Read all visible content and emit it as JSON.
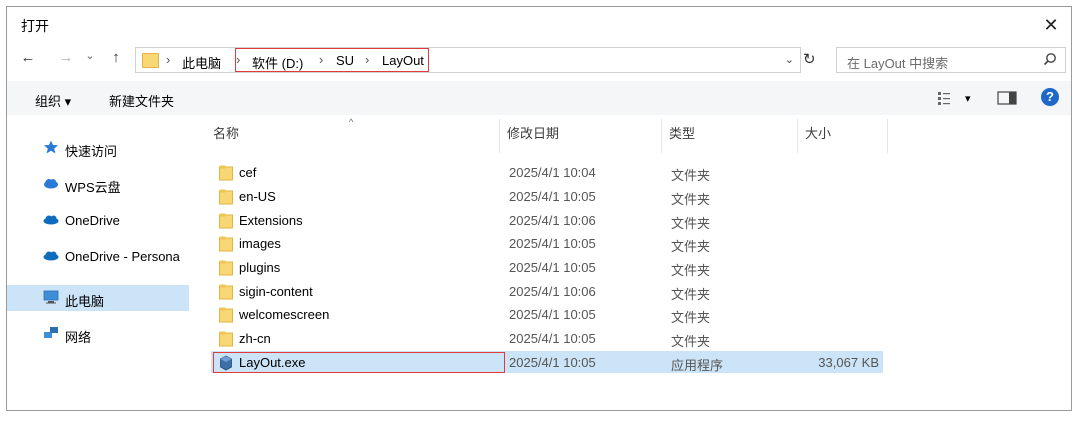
{
  "window": {
    "title": "打开",
    "close_glyph": "✕"
  },
  "nav": {
    "back_glyph": "←",
    "forward_glyph": "→",
    "recent_glyph": "⌄",
    "up_glyph": "↑",
    "refresh_glyph": "↻",
    "dropdown_glyph": "⌄"
  },
  "address": {
    "sep_glyph": "›",
    "crumbs": [
      "此电脑",
      "软件 (D:)",
      "SU",
      "LayOut"
    ]
  },
  "search": {
    "placeholder": "在 LayOut 中搜索"
  },
  "toolbar": {
    "organize_label": "组织 ▾",
    "new_folder_label": "新建文件夹",
    "view_caret": "▾",
    "help_glyph": "?"
  },
  "sidebar": {
    "items": [
      {
        "label": "快速访问",
        "icon": "star-icon",
        "selected": false
      },
      {
        "label": "WPS云盘",
        "icon": "cloud-icon",
        "selected": false
      },
      {
        "label": "OneDrive",
        "icon": "onedrive-icon",
        "selected": false
      },
      {
        "label": "OneDrive - Persona",
        "icon": "onedrive-icon",
        "selected": false
      },
      {
        "label": "此电脑",
        "icon": "computer-icon",
        "selected": true
      },
      {
        "label": "网络",
        "icon": "network-icon",
        "selected": false
      }
    ]
  },
  "columns": {
    "name": "名称",
    "modified": "修改日期",
    "type": "类型",
    "size": "大小",
    "sort_caret": "^"
  },
  "files": [
    {
      "name": "cef",
      "modified": "2025/4/1 10:04",
      "type": "文件夹",
      "size": "",
      "icon": "folder-icon"
    },
    {
      "name": "en-US",
      "modified": "2025/4/1 10:05",
      "type": "文件夹",
      "size": "",
      "icon": "folder-icon"
    },
    {
      "name": "Extensions",
      "modified": "2025/4/1 10:06",
      "type": "文件夹",
      "size": "",
      "icon": "folder-icon"
    },
    {
      "name": "images",
      "modified": "2025/4/1 10:05",
      "type": "文件夹",
      "size": "",
      "icon": "folder-icon"
    },
    {
      "name": "plugins",
      "modified": "2025/4/1 10:05",
      "type": "文件夹",
      "size": "",
      "icon": "folder-icon"
    },
    {
      "name": "sigin-content",
      "modified": "2025/4/1 10:06",
      "type": "文件夹",
      "size": "",
      "icon": "folder-icon"
    },
    {
      "name": "welcomescreen",
      "modified": "2025/4/1 10:05",
      "type": "文件夹",
      "size": "",
      "icon": "folder-icon"
    },
    {
      "name": "zh-cn",
      "modified": "2025/4/1 10:05",
      "type": "文件夹",
      "size": "",
      "icon": "folder-icon"
    },
    {
      "name": "LayOut.exe",
      "modified": "2025/4/1 10:05",
      "type": "应用程序",
      "size": "33,067 KB",
      "icon": "app-icon"
    }
  ],
  "colors": {
    "selection": "#cce4f7",
    "highlight_box": "#e03a3a",
    "help_blue": "#1f68c8"
  }
}
